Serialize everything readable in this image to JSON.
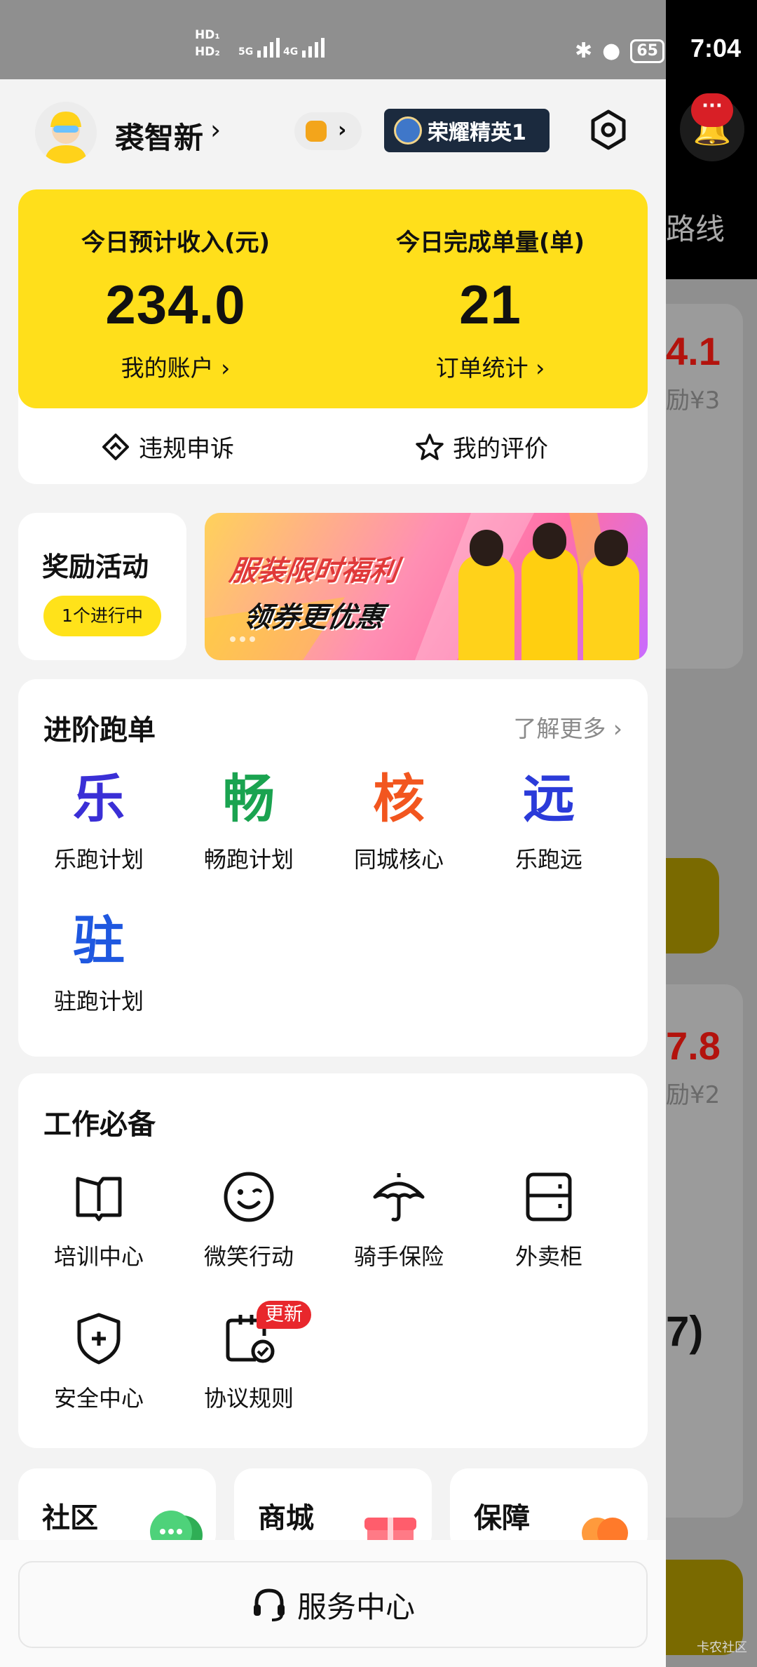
{
  "status_bar": {
    "network_top": "HD₁",
    "network_bottom": "HD₂",
    "net5g": "5G",
    "net4g": "4G",
    "battery": "65",
    "time": "7:04"
  },
  "profile": {
    "name": "裘智新",
    "honor_label": "荣耀精英1"
  },
  "income_card": {
    "income_label": "今日预计收入(元)",
    "income_value": "234.0",
    "account_link": "我的账户 ›",
    "orders_label": "今日完成单量(单)",
    "orders_value": "21",
    "orders_link": "订单统计 ›",
    "appeal_label": "违规申诉",
    "rating_label": "我的评价"
  },
  "reward": {
    "title": "奖励活动",
    "tag": "1个进行中"
  },
  "banner": {
    "line1": "服装限时福利",
    "line2": "领券更优惠"
  },
  "advanced": {
    "title": "进阶跑单",
    "more": "了解更多 ›",
    "items": [
      {
        "char": "乐",
        "label": "乐跑计划",
        "color": "#3a2fd6"
      },
      {
        "char": "畅",
        "label": "畅跑计划",
        "color": "#1aa350"
      },
      {
        "char": "核",
        "label": "同城核心",
        "color": "#f2561f"
      },
      {
        "char": "远",
        "label": "乐跑远",
        "color": "#2b3bd9"
      },
      {
        "char": "驻",
        "label": "驻跑计划",
        "color": "#1f58e0"
      }
    ]
  },
  "work": {
    "title": "工作必备",
    "items": [
      {
        "label": "培训中心",
        "icon": "book-icon"
      },
      {
        "label": "微笑行动",
        "icon": "smile-icon"
      },
      {
        "label": "骑手保险",
        "icon": "umbrella-icon"
      },
      {
        "label": "外卖柜",
        "icon": "locker-icon"
      },
      {
        "label": "安全中心",
        "icon": "shield-icon"
      },
      {
        "label": "协议规则",
        "icon": "agreement-icon"
      }
    ],
    "new_badge": "更新"
  },
  "mini_cards": {
    "community": "社区",
    "mall": "商城",
    "guarantee": "保障"
  },
  "service": {
    "label": "服务中心"
  },
  "background_page": {
    "route": "路线",
    "num1": "4.1",
    "reward1": "励¥3",
    "num2": "7.8",
    "reward2": "励¥2",
    "paren": "7)",
    "watermark": "卡农社区"
  }
}
